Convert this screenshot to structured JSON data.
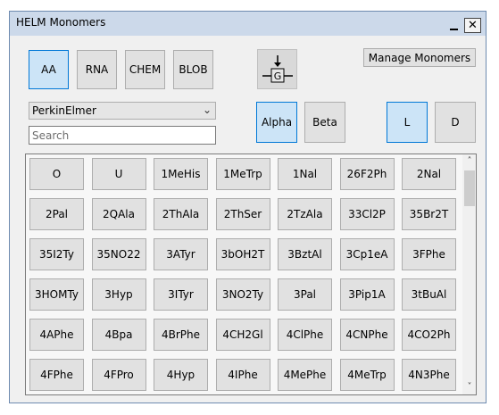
{
  "window": {
    "title": "HELM Monomers"
  },
  "titlebar": {
    "min_glyph": "",
    "close_glyph": "✕"
  },
  "types": [
    {
      "label": "AA",
      "selected": true
    },
    {
      "label": "RNA",
      "selected": false
    },
    {
      "label": "CHEM",
      "selected": false
    },
    {
      "label": "BLOB",
      "selected": false
    }
  ],
  "manage_label": "Manage Monomers",
  "alpha_label": "Alpha",
  "beta_label": "Beta",
  "l_label": "L",
  "d_label": "D",
  "source": {
    "value": "PerkinElmer"
  },
  "search": {
    "placeholder": "Search"
  },
  "monomers": [
    [
      "O",
      "U",
      "1MeHis",
      "1MeTrp",
      "1Nal",
      "26F2Ph",
      "2Nal"
    ],
    [
      "2Pal",
      "2QAla",
      "2ThAla",
      "2ThSer",
      "2TzAla",
      "33Cl2P",
      "35Br2T"
    ],
    [
      "35I2Ty",
      "35NO22",
      "3ATyr",
      "3bOH2T",
      "3BztAl",
      "3Cp1eA",
      "3FPhe"
    ],
    [
      "3HOMTy",
      "3Hyp",
      "3ITyr",
      "3NO2Ty",
      "3Pal",
      "3Pip1A",
      "3tBuAl"
    ],
    [
      "4APhe",
      "4Bpa",
      "4BrPhe",
      "4CH2Gl",
      "4ClPhe",
      "4CNPhe",
      "4CO2Ph"
    ],
    [
      "4FPhe",
      "4FPro",
      "4Hyp",
      "4IPhe",
      "4MePhe",
      "4MeTrp",
      "4N3Phe"
    ]
  ],
  "icons": {
    "g_icon": "G",
    "scroll_up": "˄",
    "scroll_down": "˅"
  }
}
